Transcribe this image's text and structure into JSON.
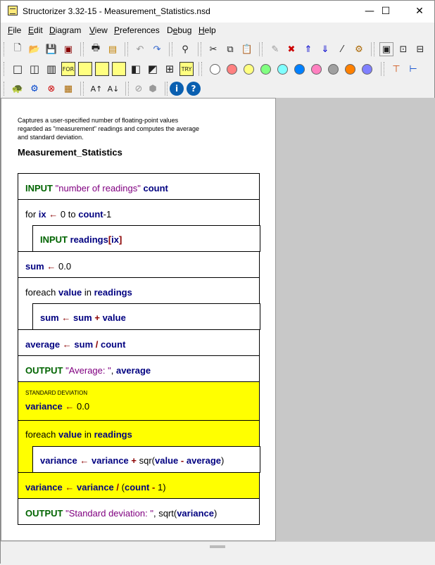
{
  "window": {
    "title": "Structorizer 3.32-15 - Measurement_Statistics.nsd",
    "controls": {
      "minimize": "—",
      "maximize": "☐",
      "close": "✕"
    }
  },
  "menu": [
    "File",
    "Edit",
    "Diagram",
    "View",
    "Preferences",
    "Debug",
    "Help"
  ],
  "toolbar1": [
    "new-icon",
    "open-icon",
    "save-icon",
    "save-all-icon",
    "print-icon",
    "export-picture-icon",
    "undo-icon",
    "redo-icon",
    "find-icon",
    "cut-icon",
    "copy-icon",
    "paste-icon",
    "comment-icon",
    "delete-icon",
    "move-up-icon",
    "move-down-icon",
    "magic-wand-icon",
    "analyser-icon",
    "zoom-fit-icon",
    "zoom-in-icon",
    "zoom-out-icon"
  ],
  "toolbar2_colors": [
    "#ffffff",
    "#ff8080",
    "#ffff80",
    "#80ff80",
    "#80ffff",
    "#0080ff",
    "#ff80c0",
    "#a0a0a0",
    "#ff8000",
    "#8080ff"
  ],
  "toolbar2_shapes": [
    "instruction",
    "alternative",
    "case",
    "for",
    "while",
    "repeat",
    "forever",
    "call",
    "jump",
    "parallel",
    "try"
  ],
  "toolbar3": [
    "turtle-icon",
    "run-icon",
    "stop-icon",
    "breakpoint-icon",
    "font-up-icon",
    "font-down-icon",
    "collapse-icon",
    "expand-icon",
    "info-icon",
    "help-icon"
  ],
  "diagram": {
    "comment": [
      "Captures a user-specified number of floating-point values",
      "regarded as \"measurement\" readings and computes the average",
      "and standard deviation."
    ],
    "title": "Measurement_Statistics",
    "highlight_color": "#ffff00"
  },
  "nsd": {
    "input_kw": "INPUT",
    "input_prompt": "\"number of readings\"",
    "input_var": "count",
    "for_kw": "for",
    "for_var": "ix",
    "arrow": "←",
    "for_start": "0",
    "for_to": "to",
    "for_end_var": "count",
    "for_end_op": "-1",
    "input2_kw": "INPUT",
    "input2_var": "readings",
    "input2_lb": "[",
    "input2_idx": "ix",
    "input2_rb": "]",
    "sum_var": "sum",
    "sum_init": "0.0",
    "foreach_kw": "foreach",
    "value_var": "value",
    "in_kw": "in",
    "readings_var": "readings",
    "plus": "+",
    "avg_var": "average",
    "div": "/",
    "output_kw": "OUTPUT",
    "output_str": "\"Average: \"",
    "comma": ",",
    "std_comment": "STANDARD DEVIATION",
    "variance_var": "variance",
    "var_init": "0.0",
    "sqr_fn": "sqr(",
    "minus": "-",
    "rparen": ")",
    "lparen": "(",
    "one": "1",
    "output2_str": "\"Standard deviation: \"",
    "sqrt_fn": "sqrt("
  }
}
